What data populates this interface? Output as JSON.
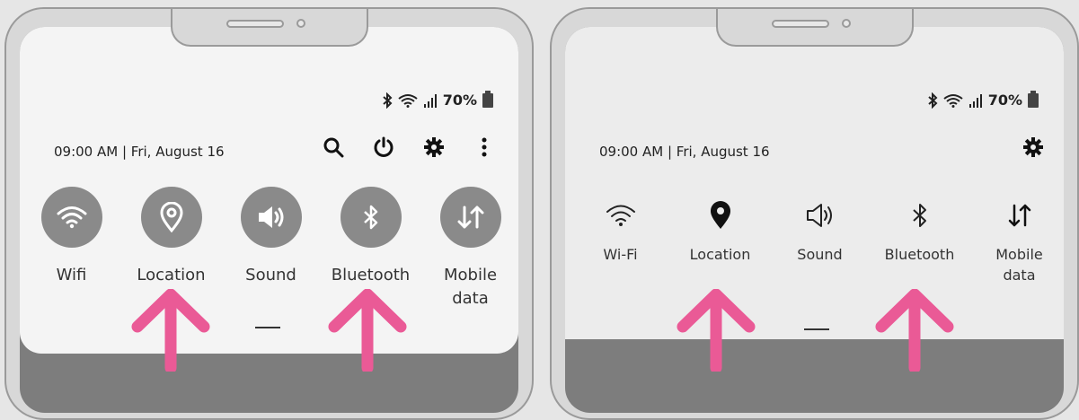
{
  "colors": {
    "arrow": "#ea5a96",
    "tile_circle": "#8a8a8a",
    "panel_bg": "#f4f4f4",
    "shade": "#7d7d7d"
  },
  "left_phone": {
    "status": {
      "battery": "70%",
      "icons": [
        "bluetooth-icon",
        "wifi-icon",
        "signal-icon",
        "battery-icon"
      ]
    },
    "datetime": "09:00 AM | Fri, August 16",
    "header_icons": [
      "search-icon",
      "power-icon",
      "gear-icon",
      "more-vertical-icon"
    ],
    "tiles": [
      {
        "icon": "wifi-icon",
        "label": "Wifi"
      },
      {
        "icon": "location-icon",
        "label": "Location"
      },
      {
        "icon": "sound-icon",
        "label": "Sound"
      },
      {
        "icon": "bluetooth-icon",
        "label": "Bluetooth"
      },
      {
        "icon": "mobile-data-icon",
        "label": "Mobile\ndata"
      }
    ],
    "highlighted": [
      "Location",
      "Bluetooth"
    ]
  },
  "right_phone": {
    "status": {
      "battery": "70%",
      "icons": [
        "bluetooth-icon",
        "wifi-icon",
        "signal-icon",
        "battery-icon"
      ]
    },
    "datetime": "09:00 AM | Fri, August 16",
    "header_icons": [
      "gear-icon"
    ],
    "tiles": [
      {
        "icon": "wifi-icon",
        "label": "Wi-Fi"
      },
      {
        "icon": "location-icon",
        "label": "Location"
      },
      {
        "icon": "sound-icon",
        "label": "Sound"
      },
      {
        "icon": "bluetooth-icon",
        "label": "Bluetooth"
      },
      {
        "icon": "mobile-data-icon",
        "label": "Mobile\ndata"
      }
    ],
    "highlighted": [
      "Location",
      "Bluetooth"
    ]
  }
}
